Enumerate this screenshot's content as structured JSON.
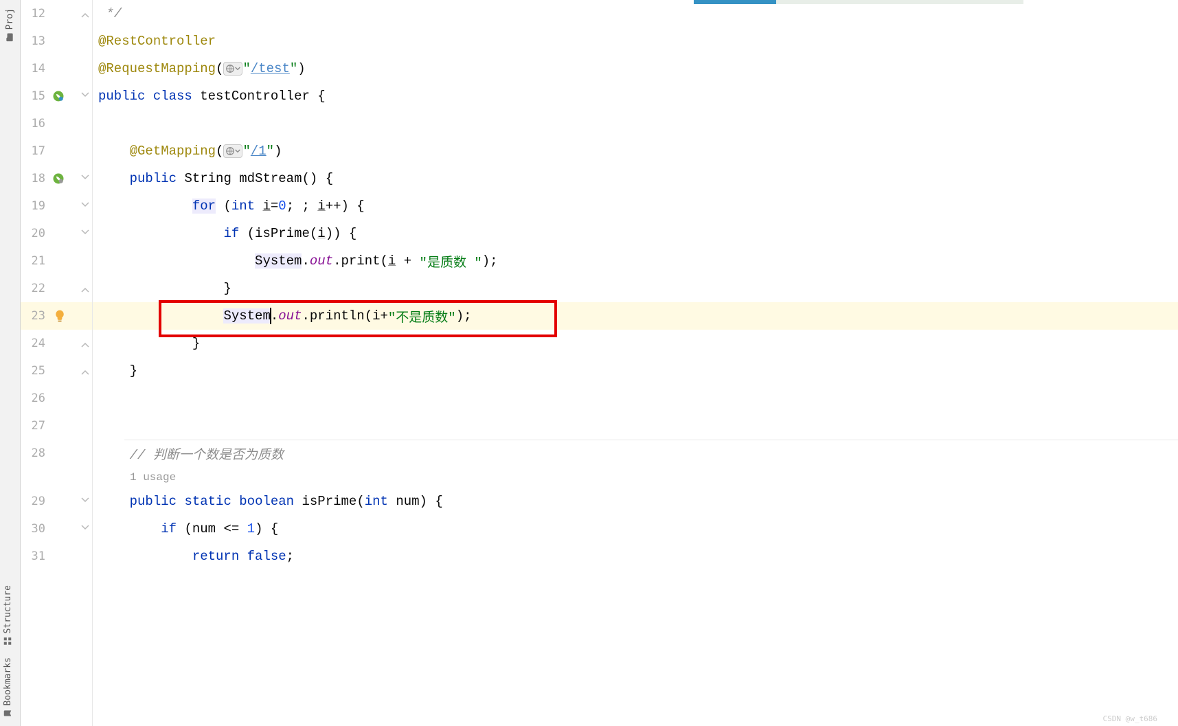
{
  "sideTabs": {
    "project": "Proj",
    "structure": "Structure",
    "bookmarks": "Bookmarks"
  },
  "lines": {
    "l12": "12",
    "l13": "13",
    "l14": "14",
    "l15": "15",
    "l16": "16",
    "l17": "17",
    "l18": "18",
    "l19": "19",
    "l20": "20",
    "l21": "21",
    "l22": "22",
    "l23": "23",
    "l24": "24",
    "l25": "25",
    "l26": "26",
    "l27": "27",
    "l28": "28",
    "l29": "29",
    "l30": "30",
    "l31": "31"
  },
  "code": {
    "l12": " */",
    "l13_ann": "@RestController",
    "l14_ann": "@RequestMapping",
    "l14_open": "(",
    "l14_str": "\"/test\"",
    "l14_close": ")",
    "l15_public": "public ",
    "l15_class": "class ",
    "l15_name": "testController ",
    "l15_brace": "{",
    "l17_ann": "@GetMapping",
    "l17_open": "(",
    "l17_str": "\"/1\"",
    "l17_close": ")",
    "l18_public": "public ",
    "l18_type": "String ",
    "l18_method": "mdStream",
    "l18_rest": "() {",
    "l19_for": "for",
    "l19_open": " (",
    "l19_int": "int ",
    "l19_var": "i",
    "l19_eq": "=",
    "l19_zero": "0",
    "l19_mid": "; ; ",
    "l19_var2": "i",
    "l19_inc": "++) {",
    "l20_if": "if ",
    "l20_call": "(isPrime(",
    "l20_var": "i",
    "l20_end": ")) {",
    "l21_sys": "System",
    "l21_dot1": ".",
    "l21_out": "out",
    "l21_print": ".print(",
    "l21_var": "i",
    "l21_plus": " + ",
    "l21_str": "\"是质数 \"",
    "l21_end": ");",
    "l22_brace": "}",
    "l23_sys": "System",
    "l23_dot1": ".",
    "l23_out": "out",
    "l23_print": ".println(i+",
    "l23_str": "\"不是质数\"",
    "l23_end": ");",
    "l24_brace": "}",
    "l25_brace": "}",
    "l28_cmt": "// 判断一个数是否为质数",
    "usage": "1 usage",
    "l29_public": "public ",
    "l29_static": "static ",
    "l29_bool": "boolean ",
    "l29_name": "isPrime",
    "l29_params": "(",
    "l29_int": "int ",
    "l29_var": "num",
    "l29_end": ") {",
    "l30_if": "if ",
    "l30_cond": "(num <= ",
    "l30_one": "1",
    "l30_end": ") {",
    "l31_return": "return ",
    "l31_false": "false",
    "l31_semi": ";"
  },
  "watermark": "CSDN @w_t686",
  "indent": {
    "zero": "",
    "one": "    ",
    "two": "        ",
    "three": "            ",
    "four": "                ",
    "five": "                    "
  }
}
